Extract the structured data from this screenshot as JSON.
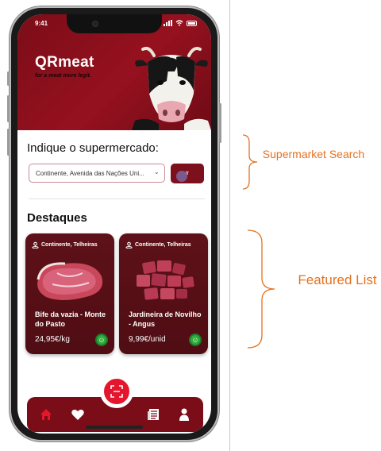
{
  "status_bar": {
    "time": "9:41"
  },
  "header": {
    "app_title": "QRmeat",
    "tagline": "for a meat more legit."
  },
  "search": {
    "title": "Indique o supermercado:",
    "selected_store": "Continente, Avenida das Nações Uni...",
    "go_label": "Ir"
  },
  "featured": {
    "title": "Destaques",
    "items": [
      {
        "store": "Continente, Telheiras",
        "name": "Bife da vazia - Monte do Pasto",
        "price": "24,95€/kg"
      },
      {
        "store": "Continente, Telheiras",
        "name": "Jardineira de Novilho - Angus",
        "price": "9,99€/unid"
      }
    ]
  },
  "nav": {
    "items": [
      {
        "icon": "home-icon",
        "active": true
      },
      {
        "icon": "heart-icon",
        "active": false
      },
      {
        "icon": "qr-scan-icon",
        "active": false
      },
      {
        "icon": "news-icon",
        "active": false
      },
      {
        "icon": "user-icon",
        "active": false
      }
    ]
  },
  "annotations": {
    "supermarket_search": "Supermarket Search",
    "featured_list": "Featured List"
  },
  "colors": {
    "brand": "#7b0d18",
    "accent": "#e4152c",
    "annotation": "#e5711f",
    "badge": "#2faa3c"
  }
}
